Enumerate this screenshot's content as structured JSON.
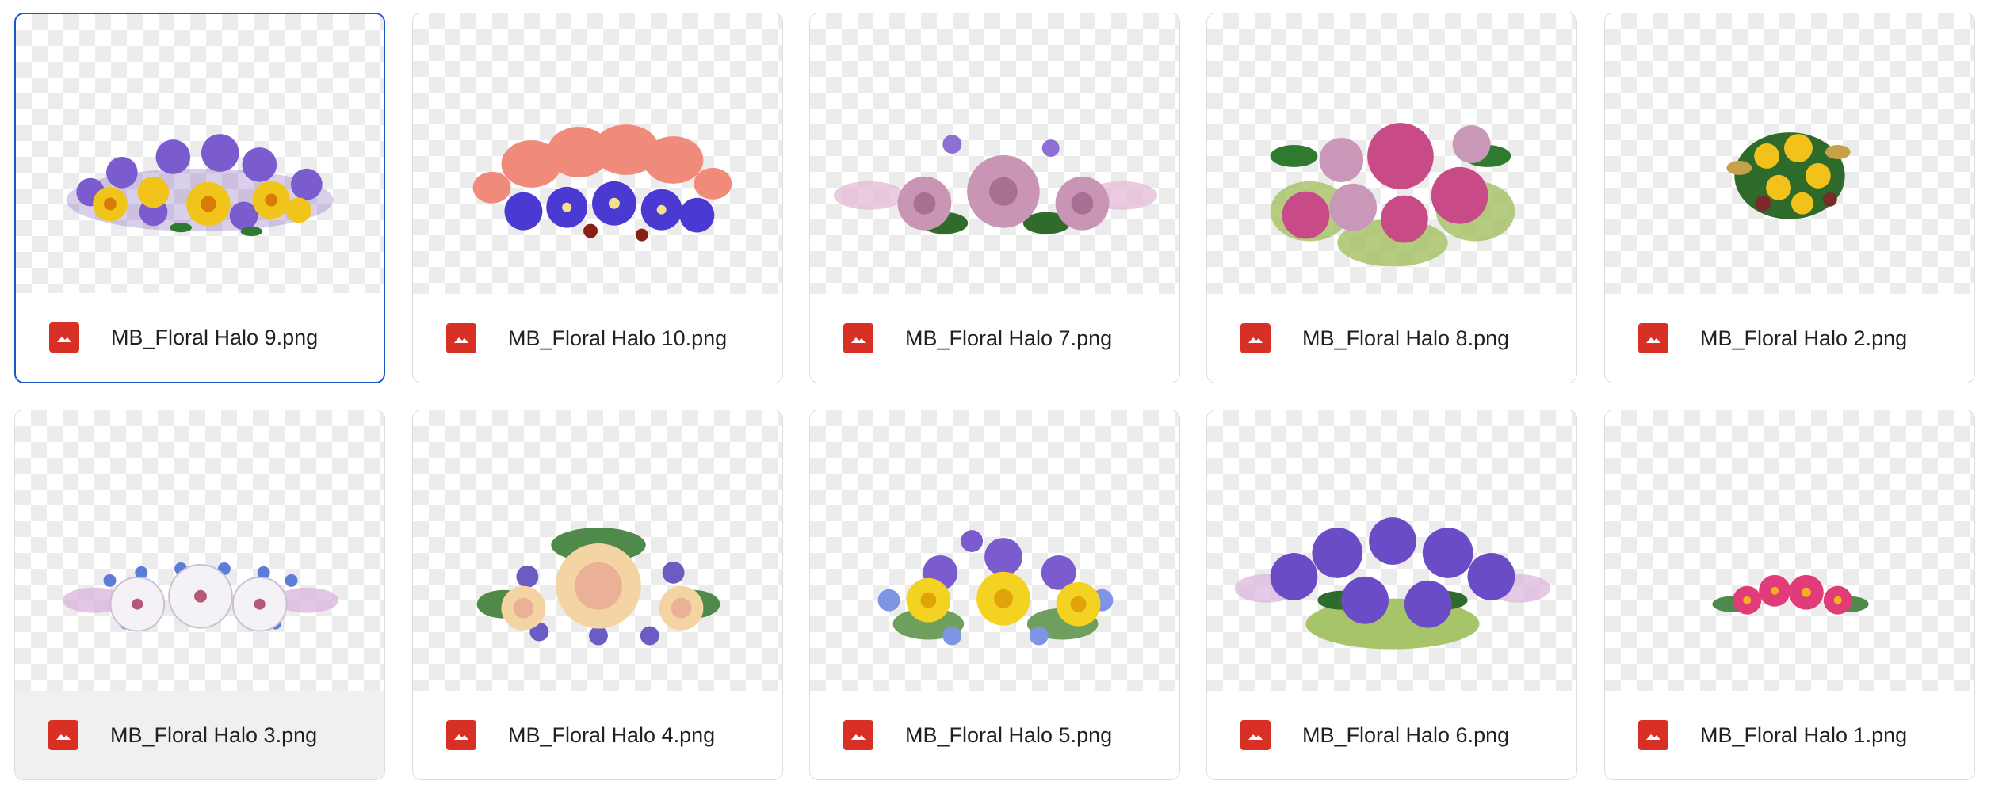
{
  "files": [
    {
      "name": "MB_Floral Halo 9.png",
      "type_icon": "image-file-icon",
      "thumbnail": "yellow lilies with purple bellflowers",
      "selected": true
    },
    {
      "name": "MB_Floral Halo 10.png",
      "type_icon": "image-file-icon",
      "thumbnail": "pink orchids with blue hepatica flowers"
    },
    {
      "name": "MB_Floral Halo 7.png",
      "type_icon": "image-file-icon",
      "thumbnail": "dusty pink roses with lavender sprigs"
    },
    {
      "name": "MB_Floral Halo 8.png",
      "type_icon": "image-file-icon",
      "thumbnail": "magenta and pink roses cluster"
    },
    {
      "name": "MB_Floral Halo 2.png",
      "type_icon": "image-file-icon",
      "thumbnail": "small yellow bouquet"
    },
    {
      "name": "MB_Floral Halo 3.png",
      "type_icon": "image-file-icon",
      "thumbnail": "white flowers with blue forget-me-nots",
      "hovered": true
    },
    {
      "name": "MB_Floral Halo 4.png",
      "type_icon": "image-file-icon",
      "thumbnail": "peach roses with purple flowers"
    },
    {
      "name": "MB_Floral Halo 5.png",
      "type_icon": "image-file-icon",
      "thumbnail": "yellow daffodils with purple bellflowers"
    },
    {
      "name": "MB_Floral Halo 6.png",
      "type_icon": "image-file-icon",
      "thumbnail": "purple bellflowers cluster"
    },
    {
      "name": "MB_Floral Halo 1.png",
      "type_icon": "image-file-icon",
      "thumbnail": "small pink flower band"
    }
  ],
  "colors": {
    "selected_border": "#1a56c4",
    "card_border": "#dadce0",
    "image_icon": "#d93025",
    "hover_footer": "#f0f0f0"
  }
}
